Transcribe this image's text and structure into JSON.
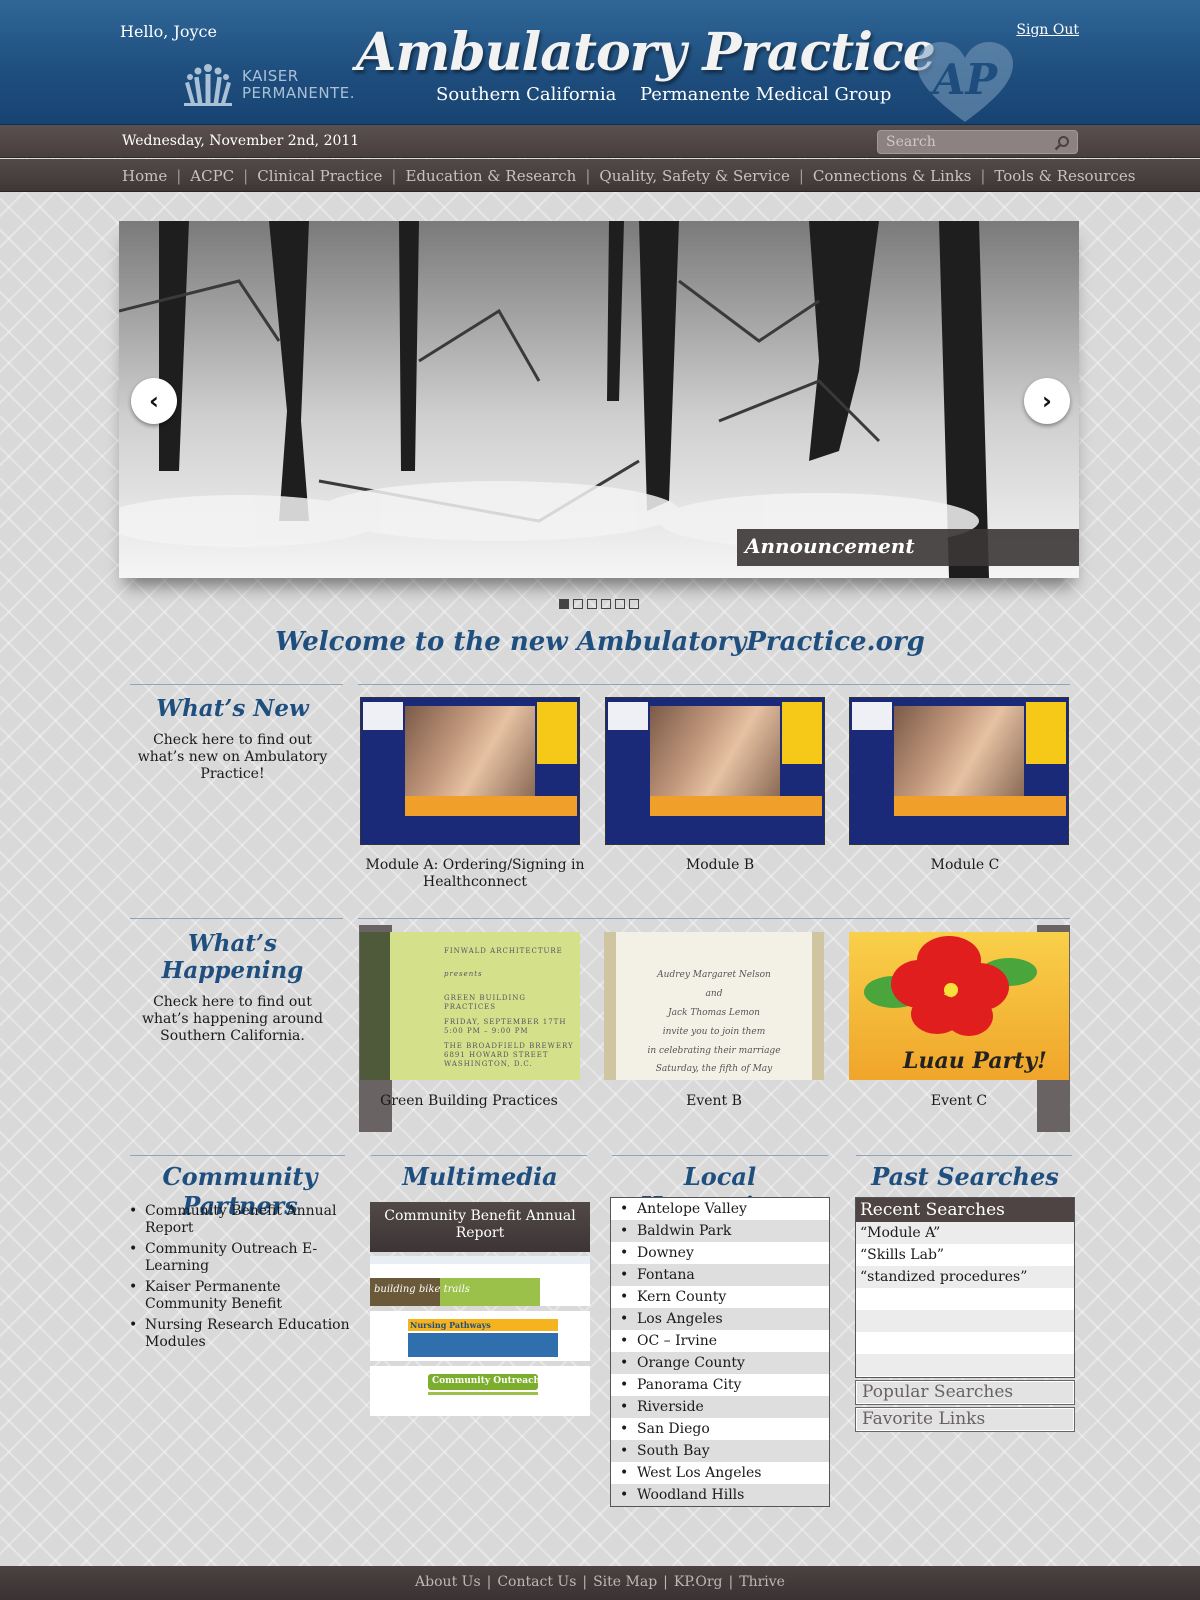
{
  "header": {
    "greeting": "Hello, Joyce",
    "sign_out": "Sign Out",
    "logo_text_line1": "KAISER",
    "logo_text_line2": "PERMANENTE.",
    "site_title": "Ambulatory Practice",
    "subtitle_left": "Southern California",
    "subtitle_right": "Permanente Medical Group",
    "ap_badge": "AP"
  },
  "datebar": {
    "date": "Wednesday, November 2nd, 2011",
    "search_placeholder": "Search"
  },
  "nav": {
    "items": [
      "Home",
      "ACPC",
      "Clinical Practice",
      "Education & Research",
      "Quality, Safety & Service",
      "Connections & Links",
      "Tools & Resources"
    ]
  },
  "slider": {
    "caption": "Announcement",
    "prev": "‹",
    "next": "›",
    "slide_count": 6,
    "active_slide": 1
  },
  "welcome": "Welcome to the new AmbulatoryPractice.org",
  "whats_new": {
    "title": "What’s New",
    "text": "Check here to find out what’s new on Ambulatory Practice!",
    "items": [
      {
        "caption": "Module A: Ordering/Signing in  Healthconnect"
      },
      {
        "caption": "Module B"
      },
      {
        "caption": "Module C"
      }
    ]
  },
  "whats_happening": {
    "title": "What’s Happening",
    "text": "Check here to find out what’s happening around Southern California.",
    "items": [
      {
        "caption": "Green Building Practices"
      },
      {
        "caption": "Event B"
      },
      {
        "caption": "Event C"
      }
    ],
    "flyer_green": [
      "FINWALD ARCHITECTURE",
      "presents",
      "GREEN BUILDING PRACTICES",
      "FRIDAY, SEPTEMBER 17TH",
      "5:00 PM – 9:00 PM",
      "THE BROADFIELD BREWERY",
      "6891 HOWARD STREET",
      "WASHINGTON, D.C."
    ],
    "flyer_cream": [
      "Audrey Margaret Nelson",
      "and",
      "Jack Thomas Lemon",
      "invite you to join them",
      "in celebrating their marriage",
      "Saturday, the fifth of May"
    ],
    "flyer_luau": "Luau Party!"
  },
  "community_partners": {
    "title": "Community Partners",
    "items": [
      "Community Benefit Annual Report",
      "Community Outreach E-Learning",
      "Kaiser Permanente Community Benefit",
      "Nursing Research Education Modules"
    ]
  },
  "multimedia": {
    "title": "Multimedia",
    "feature_label": "Community Benefit Annual Report",
    "thumb_labels": [
      "building bike trails",
      "Nursing Pathways",
      "Community Outreach"
    ]
  },
  "local_happenings": {
    "title": "Local Happenings",
    "items": [
      "Antelope Valley",
      "Baldwin Park",
      "Downey",
      "Fontana",
      "Kern County",
      "Los Angeles",
      "OC – Irvine",
      "Orange County",
      "Panorama City",
      "Riverside",
      "San Diego",
      "South Bay",
      "West Los Angeles",
      "Woodland Hills"
    ]
  },
  "past_searches": {
    "title": "Past Searches",
    "recent_header": "Recent Searches",
    "recent": [
      "“Module A”",
      "“Skills Lab”",
      "“standized procedures”"
    ],
    "popular_tab": "Popular Searches",
    "favorite_tab": "Favorite Links"
  },
  "footer": {
    "links": [
      "About Us",
      "Contact Us",
      "Site Map",
      "KP.Org",
      "Thrive"
    ]
  },
  "colors": {
    "header_blue": "#1f4f7f",
    "bar_brown": "#4b4242",
    "heading_blue": "#1f4f7f"
  }
}
